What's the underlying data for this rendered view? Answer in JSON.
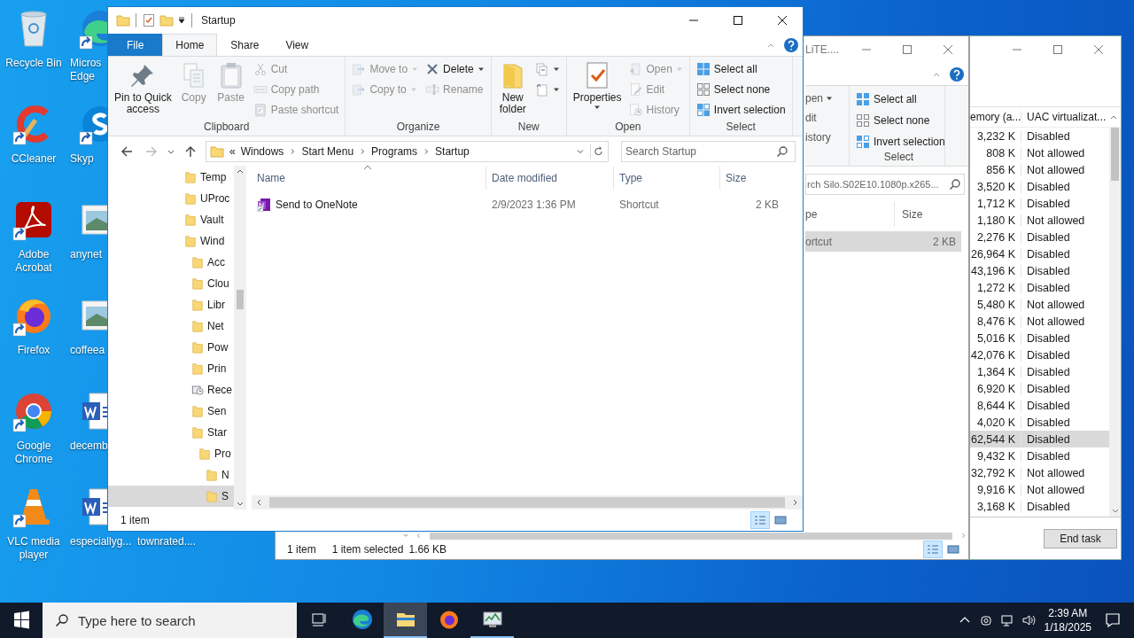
{
  "desktop": {
    "columns": [
      [
        {
          "kind": "recycle",
          "shortcut": false,
          "lines": [
            "Recycle Bin"
          ]
        },
        {
          "kind": "ccleaner",
          "shortcut": true,
          "lines": [
            "CCleaner"
          ]
        },
        {
          "kind": "acrobat",
          "shortcut": true,
          "lines": [
            "Adobe",
            "Acrobat"
          ]
        },
        {
          "kind": "firefox",
          "shortcut": true,
          "lines": [
            "Firefox"
          ]
        },
        {
          "kind": "chrome",
          "shortcut": true,
          "lines": [
            "Google",
            "Chrome"
          ]
        },
        {
          "kind": "vlc",
          "shortcut": true,
          "lines": [
            "VLC media",
            "player"
          ]
        }
      ],
      [
        {
          "kind": "edge",
          "shortcut": true,
          "lines": [
            "Micros",
            "Edge"
          ]
        },
        {
          "kind": "skype",
          "shortcut": true,
          "lines": [
            "Skyp"
          ]
        },
        {
          "kind": "image",
          "shortcut": false,
          "lines": [
            "anynet"
          ]
        },
        {
          "kind": "image",
          "shortcut": false,
          "lines": [
            "coffeea"
          ]
        },
        {
          "kind": "word",
          "shortcut": false,
          "lines": [
            "decemb"
          ]
        },
        {
          "kind": "word",
          "shortcut": false,
          "lines": [
            "especiallyg..."
          ]
        }
      ],
      [
        {
          "lines": [
            "townrated...."
          ]
        }
      ]
    ]
  },
  "task_manager": {
    "columns": [
      "emory (a...",
      "UAC virtualizat..."
    ],
    "rows": [
      {
        "memory": "3,232 K",
        "uac": "Disabled",
        "selected": false
      },
      {
        "memory": "808 K",
        "uac": "Not allowed",
        "selected": false
      },
      {
        "memory": "856 K",
        "uac": "Not allowed",
        "selected": false
      },
      {
        "memory": "3,520 K",
        "uac": "Disabled",
        "selected": false
      },
      {
        "memory": "1,712 K",
        "uac": "Disabled",
        "selected": false
      },
      {
        "memory": "1,180 K",
        "uac": "Not allowed",
        "selected": false
      },
      {
        "memory": "2,276 K",
        "uac": "Disabled",
        "selected": false
      },
      {
        "memory": "26,964 K",
        "uac": "Disabled",
        "selected": false
      },
      {
        "memory": "43,196 K",
        "uac": "Disabled",
        "selected": false
      },
      {
        "memory": "1,272 K",
        "uac": "Disabled",
        "selected": false
      },
      {
        "memory": "5,480 K",
        "uac": "Not allowed",
        "selected": false
      },
      {
        "memory": "8,476 K",
        "uac": "Not allowed",
        "selected": false
      },
      {
        "memory": "5,016 K",
        "uac": "Disabled",
        "selected": false
      },
      {
        "memory": "42,076 K",
        "uac": "Disabled",
        "selected": false
      },
      {
        "memory": "1,364 K",
        "uac": "Disabled",
        "selected": false
      },
      {
        "memory": "6,920 K",
        "uac": "Disabled",
        "selected": false
      },
      {
        "memory": "8,644 K",
        "uac": "Disabled",
        "selected": false
      },
      {
        "memory": "4,020 K",
        "uac": "Disabled",
        "selected": false
      },
      {
        "memory": "62,544 K",
        "uac": "Disabled",
        "selected": true
      },
      {
        "memory": "9,432 K",
        "uac": "Disabled",
        "selected": false
      },
      {
        "memory": "32,792 K",
        "uac": "Not allowed",
        "selected": false
      },
      {
        "memory": "9,916 K",
        "uac": "Not allowed",
        "selected": false
      },
      {
        "memory": "3,168 K",
        "uac": "Disabled",
        "selected": false
      }
    ],
    "end_task": "End task"
  },
  "back_explorer": {
    "title": "LiTE....",
    "open_commands": [
      {
        "label": "pen",
        "dropdown": true
      },
      {
        "label": "dit",
        "dropdown": false
      },
      {
        "label": "istory",
        "dropdown": false
      }
    ],
    "select_commands": [
      {
        "kind": "selectall",
        "label": "Select all"
      },
      {
        "kind": "selectnone",
        "label": "Select none"
      },
      {
        "kind": "invert",
        "label": "Invert selection"
      }
    ],
    "select_label": "Select",
    "search": {
      "placeholder": "rch Silo.S02E10.1080p.x265..."
    },
    "columns": [
      "pe",
      "Size"
    ],
    "rows": [
      {
        "type": "ortcut",
        "size": "2 KB",
        "selected": true
      }
    ],
    "status": {
      "items": "1 item",
      "selection": "1 item selected",
      "size": "1.66 KB"
    },
    "views": [
      {
        "kind": "details",
        "selected": true
      },
      {
        "kind": "large",
        "selected": false
      }
    ]
  },
  "explorer": {
    "title": "Startup",
    "tabs": [
      {
        "label": "File",
        "kind": "file",
        "selected": false
      },
      {
        "label": "Home",
        "kind": "tab",
        "selected": true
      },
      {
        "label": "Share",
        "kind": "tab",
        "selected": false
      },
      {
        "label": "View",
        "kind": "tab",
        "selected": false
      }
    ],
    "groups": [
      {
        "label": "Clipboard",
        "columns": [
          {
            "kind": "large",
            "items": [
              {
                "kind": "pin",
                "label": "Pin to Quick\naccess",
                "disabled": false,
                "dropdown": false
              }
            ]
          },
          {
            "kind": "large",
            "items": [
              {
                "kind": "copy",
                "label": "Copy",
                "disabled": true,
                "dropdown": false
              }
            ]
          },
          {
            "kind": "large",
            "items": [
              {
                "kind": "paste",
                "label": "Paste",
                "disabled": true,
                "dropdown": false
              }
            ]
          },
          {
            "kind": "small",
            "items": [
              {
                "kind": "cut",
                "label": "Cut",
                "disabled": true,
                "dropdown": false
              },
              {
                "kind": "copypath",
                "label": "Copy path",
                "disabled": true,
                "dropdown": false
              },
              {
                "kind": "pasteshortcut",
                "label": "Paste shortcut",
                "disabled": true,
                "dropdown": false
              }
            ]
          }
        ]
      },
      {
        "label": "Organize",
        "columns": [
          {
            "kind": "small",
            "items": [
              {
                "kind": "moveto",
                "label": "Move to",
                "disabled": true,
                "dropdown": true
              },
              {
                "kind": "copyto",
                "label": "Copy to",
                "disabled": true,
                "dropdown": true
              }
            ]
          },
          {
            "kind": "small",
            "items": [
              {
                "kind": "delete",
                "label": "Delete",
                "disabled": false,
                "dropdown": true
              },
              {
                "kind": "rename",
                "label": "Rename",
                "disabled": true,
                "dropdown": false
              }
            ]
          }
        ]
      },
      {
        "label": "New",
        "columns": [
          {
            "kind": "large",
            "items": [
              {
                "kind": "newfolder",
                "label": "New\nfolder",
                "disabled": false,
                "dropdown": false
              }
            ]
          },
          {
            "kind": "small",
            "items": [
              {
                "kind": "newitem",
                "disabled": false,
                "dropdown": true
              },
              {
                "kind": "easyaccess",
                "disabled": false,
                "dropdown": true
              }
            ]
          }
        ]
      },
      {
        "label": "Open",
        "columns": [
          {
            "kind": "large",
            "items": [
              {
                "kind": "properties",
                "label": "Properties",
                "disabled": false,
                "dropdown": true
              }
            ]
          },
          {
            "kind": "small",
            "items": [
              {
                "kind": "open",
                "label": "Open",
                "disabled": true,
                "dropdown": true
              },
              {
                "kind": "edit",
                "label": "Edit",
                "disabled": true,
                "dropdown": false
              },
              {
                "kind": "history",
                "label": "History",
                "disabled": true,
                "dropdown": false
              }
            ]
          }
        ]
      },
      {
        "label": "Select",
        "columns": [
          {
            "kind": "small",
            "items": [
              {
                "kind": "selectall",
                "label": "Select all",
                "disabled": false,
                "dropdown": false
              },
              {
                "kind": "selectnone",
                "label": "Select none",
                "disabled": false,
                "dropdown": false
              },
              {
                "kind": "invert",
                "label": "Invert selection",
                "disabled": false,
                "dropdown": false
              }
            ]
          }
        ]
      }
    ],
    "breadcrumb_overflow": "«",
    "breadcrumbs": [
      "Windows",
      "Start Menu",
      "Programs",
      "Startup"
    ],
    "search": {
      "placeholder": "Search Startup"
    },
    "nav": [
      {
        "label": "Temp",
        "kind": "folder",
        "selected": false
      },
      {
        "label": "UProc",
        "kind": "folder",
        "selected": false
      },
      {
        "label": "Vault",
        "kind": "folder",
        "selected": false
      },
      {
        "label": "Wind",
        "kind": "folder",
        "selected": false,
        "children": [
          {
            "label": "Acc",
            "kind": "folder",
            "selected": false
          },
          {
            "label": "Clou",
            "kind": "folder",
            "selected": false
          },
          {
            "label": "Libr",
            "kind": "folder",
            "selected": false
          },
          {
            "label": "Net",
            "kind": "folder",
            "selected": false
          },
          {
            "label": "Pow",
            "kind": "folder",
            "selected": false
          },
          {
            "label": "Prin",
            "kind": "folder",
            "selected": false
          },
          {
            "label": "Rece",
            "kind": "recent",
            "selected": false
          },
          {
            "label": "Sen",
            "kind": "folder",
            "selected": false
          },
          {
            "label": "Star",
            "kind": "folder",
            "selected": false,
            "children": [
              {
                "label": "Pro",
                "kind": "folder",
                "selected": false,
                "children": [
                  {
                    "label": "N",
                    "kind": "folder",
                    "selected": false
                  },
                  {
                    "label": "S",
                    "kind": "folder",
                    "selected": true
                  }
                ]
              }
            ]
          }
        ]
      }
    ],
    "columns": [
      "Name",
      "Date modified",
      "Type",
      "Size"
    ],
    "files": [
      {
        "name": "Send to OneNote",
        "date": "2/9/2023 1:36 PM",
        "type": "Shortcut",
        "size": "2 KB",
        "selected": false
      }
    ],
    "status": "1 item",
    "views": [
      {
        "kind": "details",
        "selected": true
      },
      {
        "kind": "large",
        "selected": false
      }
    ]
  },
  "taskbar": {
    "search": {
      "placeholder": "Type here to search"
    },
    "apps": [
      {
        "kind": "taskview",
        "open": false,
        "selected": false
      },
      {
        "kind": "edge",
        "open": false,
        "selected": false
      },
      {
        "kind": "explorer",
        "open": true,
        "selected": true
      },
      {
        "kind": "firefox",
        "open": false,
        "selected": false
      },
      {
        "kind": "taskmgr",
        "open": true,
        "selected": false
      }
    ],
    "time": "2:39 AM",
    "date": "1/18/2025"
  }
}
